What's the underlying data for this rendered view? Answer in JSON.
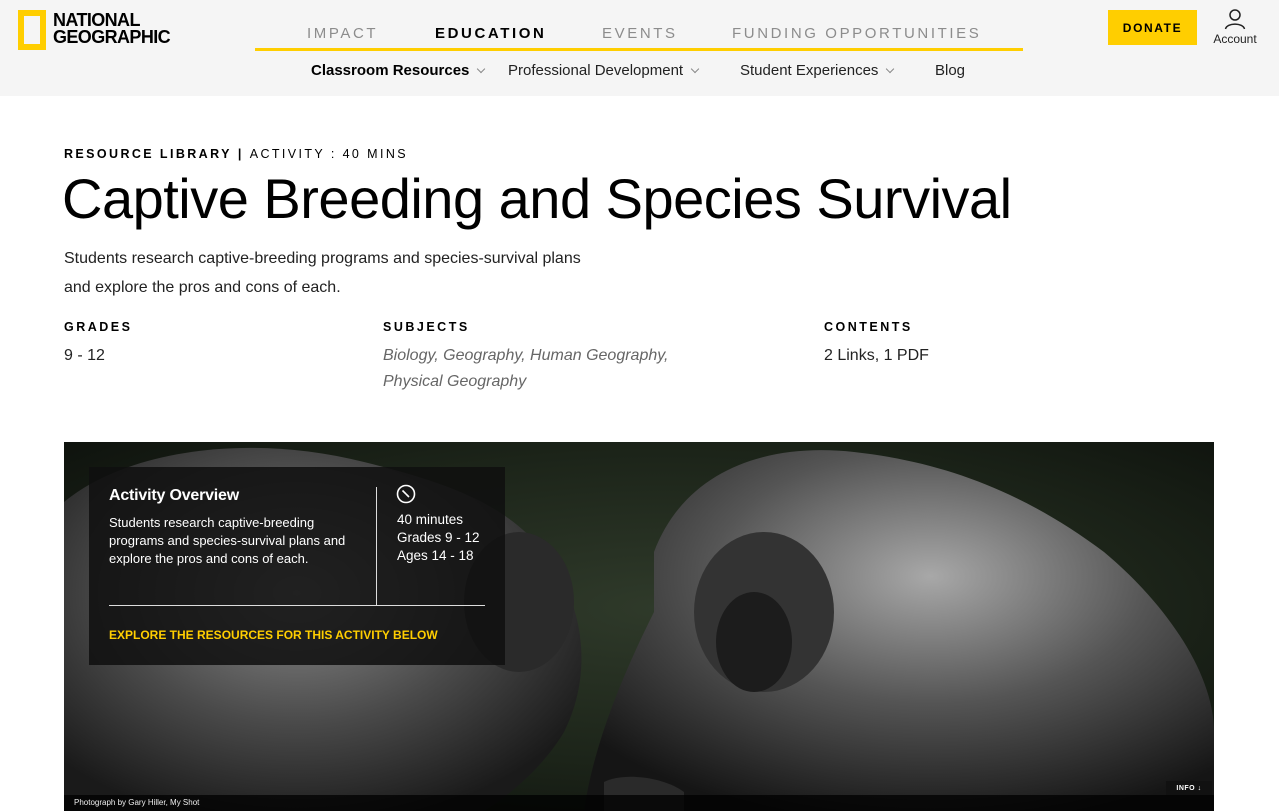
{
  "brand": {
    "line1": "NATIONAL",
    "line2": "GEOGRAPHIC"
  },
  "main_nav": [
    {
      "label": "IMPACT"
    },
    {
      "label": "EDUCATION"
    },
    {
      "label": "EVENTS"
    },
    {
      "label": "FUNDING OPPORTUNITIES"
    }
  ],
  "sub_nav": [
    {
      "label": "Classroom Resources"
    },
    {
      "label": "Professional Development"
    },
    {
      "label": "Student Experiences"
    },
    {
      "label": "Blog"
    }
  ],
  "header": {
    "donate": "DONATE",
    "account": "Account"
  },
  "resource": {
    "library": "RESOURCE LIBRARY",
    "separator": "|",
    "type": "ACTIVITY : 40 MINS",
    "title": "Captive Breeding and Species Survival",
    "description_line1": "Students research captive-breeding programs and species-survival plans",
    "description_line2": "and explore the pros and cons of each."
  },
  "meta": {
    "grades_label": "GRADES",
    "grades_value": "9 - 12",
    "subjects_label": "SUBJECTS",
    "subjects_line1": "Biology, Geography, Human Geography,",
    "subjects_line2": "Physical Geography",
    "contents_label": "CONTENTS",
    "contents_value": "2 Links, 1 PDF"
  },
  "overview": {
    "title": "Activity Overview",
    "text": "Students research captive-breeding programs and species-survival plans and explore the pros and cons of each.",
    "duration": "40 minutes",
    "grades": "Grades 9 - 12",
    "ages": "Ages 14 - 18",
    "cta": "EXPLORE THE RESOURCES FOR THIS ACTIVITY BELOW"
  },
  "hero": {
    "info": "INFO ↓",
    "credit": "Photograph by Gary Hiller, My Shot"
  },
  "icons": {
    "clock": "clock-icon",
    "account": "account-icon",
    "chevron": "chevron-down-icon"
  },
  "colors": {
    "accent": "#ffce00",
    "header_bg": "#f5f5f5"
  }
}
